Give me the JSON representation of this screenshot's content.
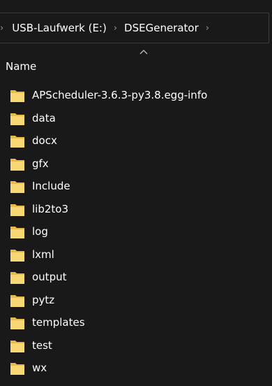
{
  "addressbar": {
    "crumbs": [
      "USB-Laufwerk (E:)",
      "DSEGenerator"
    ],
    "separator": "›"
  },
  "column_header": {
    "name_label": "Name"
  },
  "files": [
    {
      "name": "APScheduler-3.6.3-py3.8.egg-info",
      "icon": "folder-icon"
    },
    {
      "name": "data",
      "icon": "folder-icon"
    },
    {
      "name": "docx",
      "icon": "folder-icon"
    },
    {
      "name": "gfx",
      "icon": "folder-icon"
    },
    {
      "name": "Include",
      "icon": "folder-icon"
    },
    {
      "name": "lib2to3",
      "icon": "folder-icon"
    },
    {
      "name": "log",
      "icon": "folder-icon"
    },
    {
      "name": "lxml",
      "icon": "folder-icon"
    },
    {
      "name": "output",
      "icon": "folder-icon"
    },
    {
      "name": "pytz",
      "icon": "folder-icon"
    },
    {
      "name": "templates",
      "icon": "folder-icon"
    },
    {
      "name": "test",
      "icon": "folder-icon"
    },
    {
      "name": "wx",
      "icon": "folder-icon"
    }
  ],
  "colors": {
    "background": "#191919",
    "folder": "#f8d775",
    "folder_dark": "#e9b84a",
    "text": "#ffffff"
  }
}
